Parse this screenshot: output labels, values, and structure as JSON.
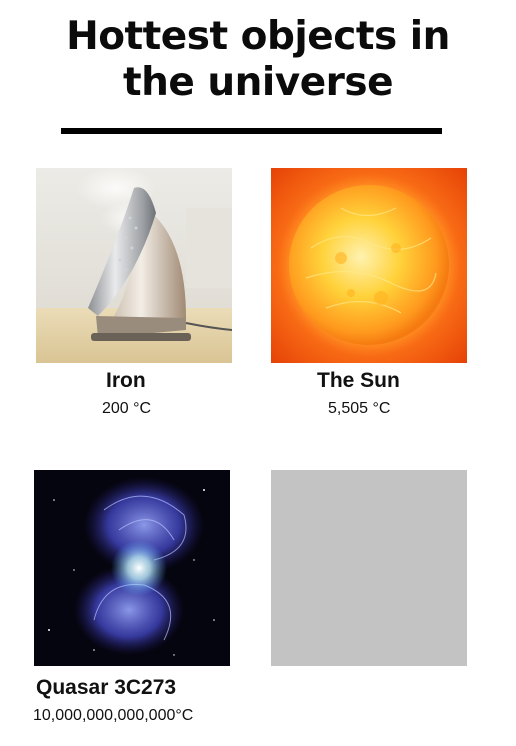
{
  "title": {
    "line1": "Hottest objects in",
    "line2": "the universe"
  },
  "items": [
    {
      "name": "Iron",
      "temperature": "200 °C",
      "image_icon": "clothes-iron-icon"
    },
    {
      "name": "The Sun",
      "temperature": "5,505 °C",
      "image_icon": "sun-icon"
    },
    {
      "name": "Quasar 3C273",
      "temperature": "10,000,000,000,000°C",
      "image_icon": "quasar-icon"
    },
    {
      "name": "",
      "temperature": "",
      "image_icon": "blank-placeholder"
    }
  ],
  "colors": {
    "placeholder_grey": "#c3c3c3",
    "sun_core": "#ffd23a",
    "sun_background": "#f04a06",
    "space_background": "#050510",
    "quasar_glow": "#5a6cff"
  }
}
